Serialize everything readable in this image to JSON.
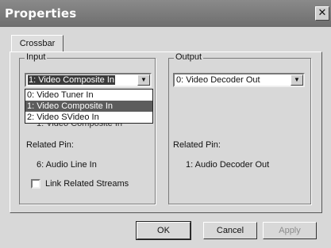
{
  "window": {
    "title": "Properties",
    "close_glyph": "✕"
  },
  "tabs": [
    {
      "label": "Crossbar"
    }
  ],
  "input": {
    "legend": "Input",
    "selected": "1: Video Composite In",
    "options": [
      "0: Video Tuner In",
      "1: Video Composite In",
      "2: Video SVideo In"
    ],
    "selected_index": 1,
    "ghost_text": "1: Video Composite In",
    "related_pin_label": "Related Pin:",
    "related_pin_value": "6: Audio Line In",
    "link_label": "Link Related Streams",
    "link_checked": false
  },
  "output": {
    "legend": "Output",
    "selected": "0: Video Decoder Out",
    "related_pin_label": "Related Pin:",
    "related_pin_value": "1: Audio Decoder Out"
  },
  "buttons": {
    "ok": "OK",
    "cancel": "Cancel",
    "apply": "Apply"
  },
  "icons": {
    "dropdown": "chevron-down-icon",
    "close": "close-icon"
  }
}
